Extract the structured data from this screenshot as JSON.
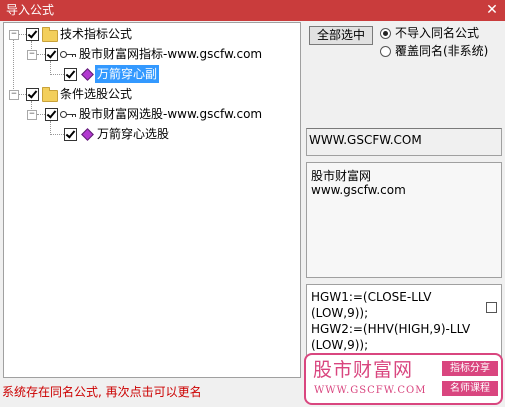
{
  "window": {
    "title": "导入公式",
    "close_glyph": "✕"
  },
  "tree": {
    "groups": [
      {
        "label": "技术指标公式",
        "child": {
          "label": "股市财富网指标-www.gscfw.com",
          "leaf": "万箭穿心副",
          "leaf_selected": true
        }
      },
      {
        "label": "条件选股公式",
        "child": {
          "label": "股市财富网选股-www.gscfw.com",
          "leaf": "万箭穿心选股",
          "leaf_selected": false
        }
      }
    ],
    "expander_glyph": "−"
  },
  "controls": {
    "select_all_button": "全部选中",
    "radio_options": [
      {
        "label": "不导入同名公式",
        "checked": true
      },
      {
        "label": "覆盖同名(非系统)",
        "checked": false
      }
    ]
  },
  "info": {
    "site": "WWW.GSCFW.COM",
    "desc_line1": "股市财富网",
    "desc_line2": "www.gscfw.com"
  },
  "code": {
    "text": "HGW1:=(CLOSE-LLV\n(LOW,9));\nHGW2:=(HHV(HIGH,9)-LLV\n(LOW,9));"
  },
  "status": {
    "message": "系统存在同名公式, 再次点击可以更名"
  },
  "watermark": {
    "name": "股市财富网",
    "url": "WWW.GSCFW.COM",
    "tag1": "指标分享",
    "tag2": "名师课程"
  },
  "colors": {
    "titlebar": "#c93c3c",
    "selection": "#3399ff",
    "status": "#cc0000",
    "watermark": "#d9467f"
  },
  "icons": [
    "close-icon",
    "expander-icon",
    "checkbox-icon",
    "folder-icon",
    "key-icon",
    "formula-gem-icon",
    "radio-icon"
  ]
}
